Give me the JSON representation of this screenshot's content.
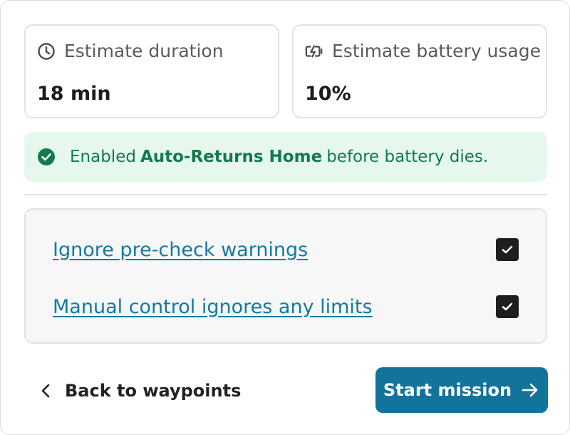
{
  "stats": {
    "duration": {
      "label": "Estimate duration",
      "value": "18 min",
      "icon": "clock-icon"
    },
    "battery": {
      "label": "Estimate battery usage",
      "value": "10%",
      "icon": "battery-charging-icon"
    }
  },
  "notice": {
    "icon": "check-circle-icon",
    "prefix": "Enabled",
    "highlight": "Auto-Returns Home",
    "suffix": "before battery dies.",
    "color": "#127a4b",
    "background": "#e6f8ee"
  },
  "options": [
    {
      "label": "Ignore pre-check warnings",
      "checked": true
    },
    {
      "label": "Manual control ignores any limits",
      "checked": true
    }
  ],
  "actions": {
    "back_label": "Back to waypoints",
    "start_label": "Start mission",
    "accent": "#12739b"
  }
}
